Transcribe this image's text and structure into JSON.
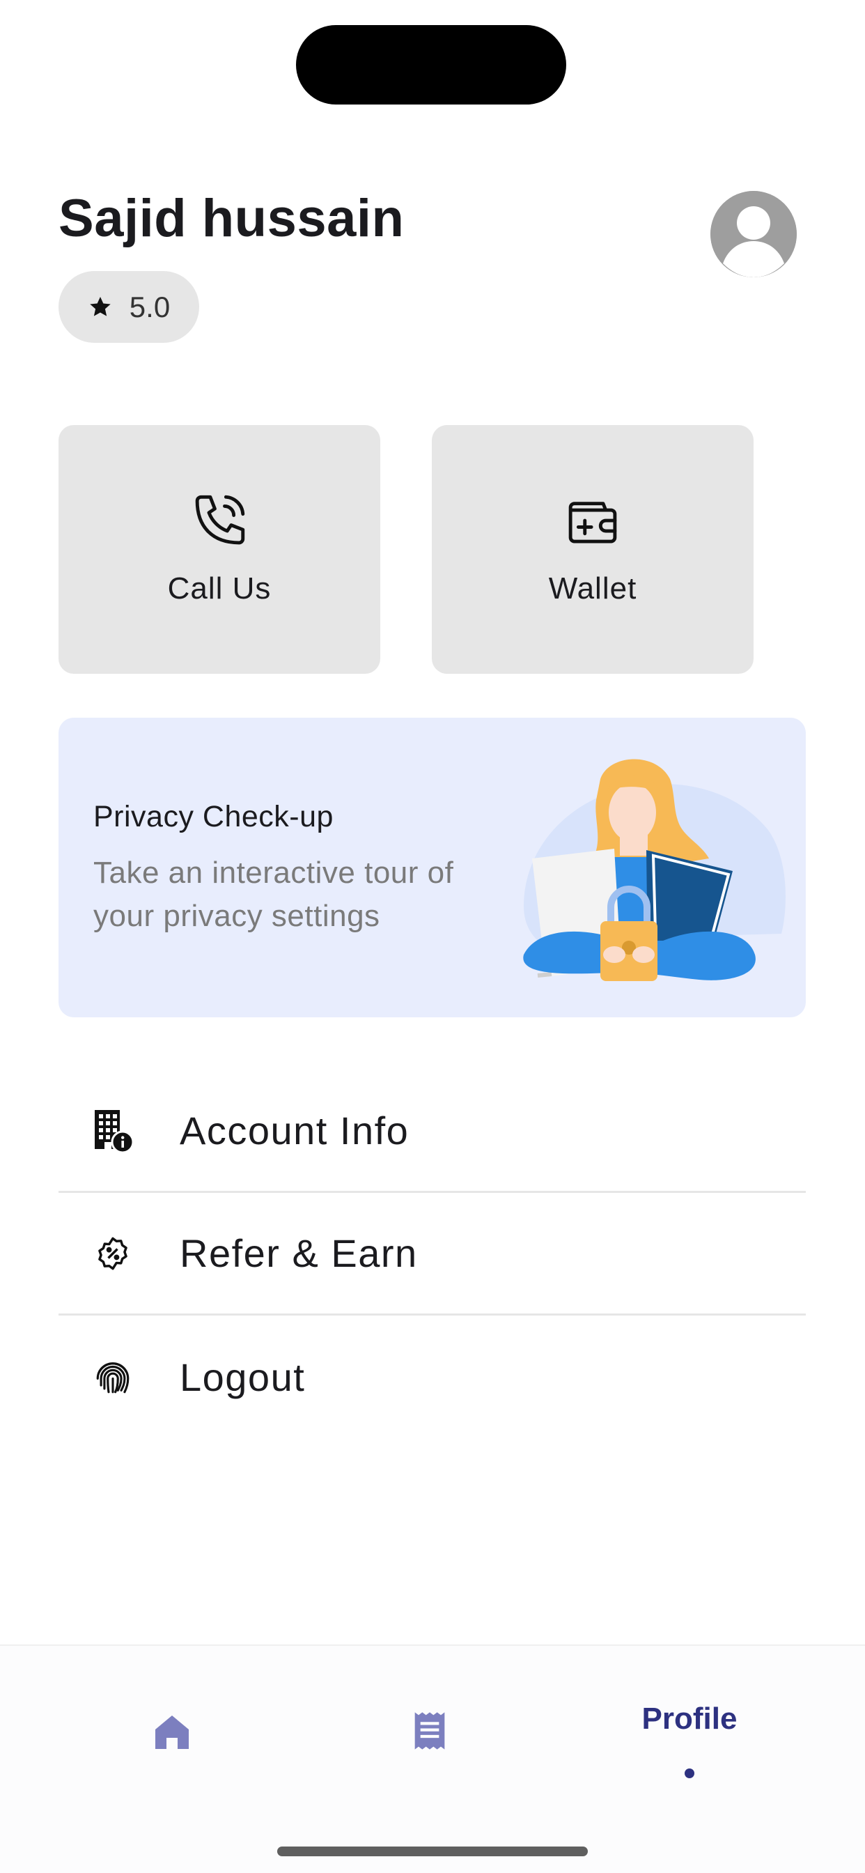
{
  "profile": {
    "name": "Sajid hussain",
    "rating": "5.0",
    "avatar_icon": "user-avatar-icon"
  },
  "quick_actions": [
    {
      "label": "Call Us",
      "icon": "phone-call-icon"
    },
    {
      "label": "Wallet",
      "icon": "wallet-icon"
    }
  ],
  "privacy_card": {
    "title": "Privacy Check-up",
    "description": "Take an interactive tour of your privacy settings"
  },
  "menu": [
    {
      "label": "Account Info",
      "icon": "building-info-icon"
    },
    {
      "label": "Refer & Earn",
      "icon": "discount-badge-icon"
    },
    {
      "label": "Logout",
      "icon": "fingerprint-icon"
    }
  ],
  "bottom_nav": {
    "items": [
      {
        "name": "home",
        "icon": "home-icon"
      },
      {
        "name": "orders",
        "icon": "receipt-icon"
      },
      {
        "name": "profile",
        "label": "Profile"
      }
    ],
    "active": "profile"
  },
  "colors": {
    "accent": "#2d3180",
    "nav_inactive": "#7c7fbf",
    "tile_bg": "#e6e6e6",
    "privacy_bg": "#e8edfd"
  }
}
